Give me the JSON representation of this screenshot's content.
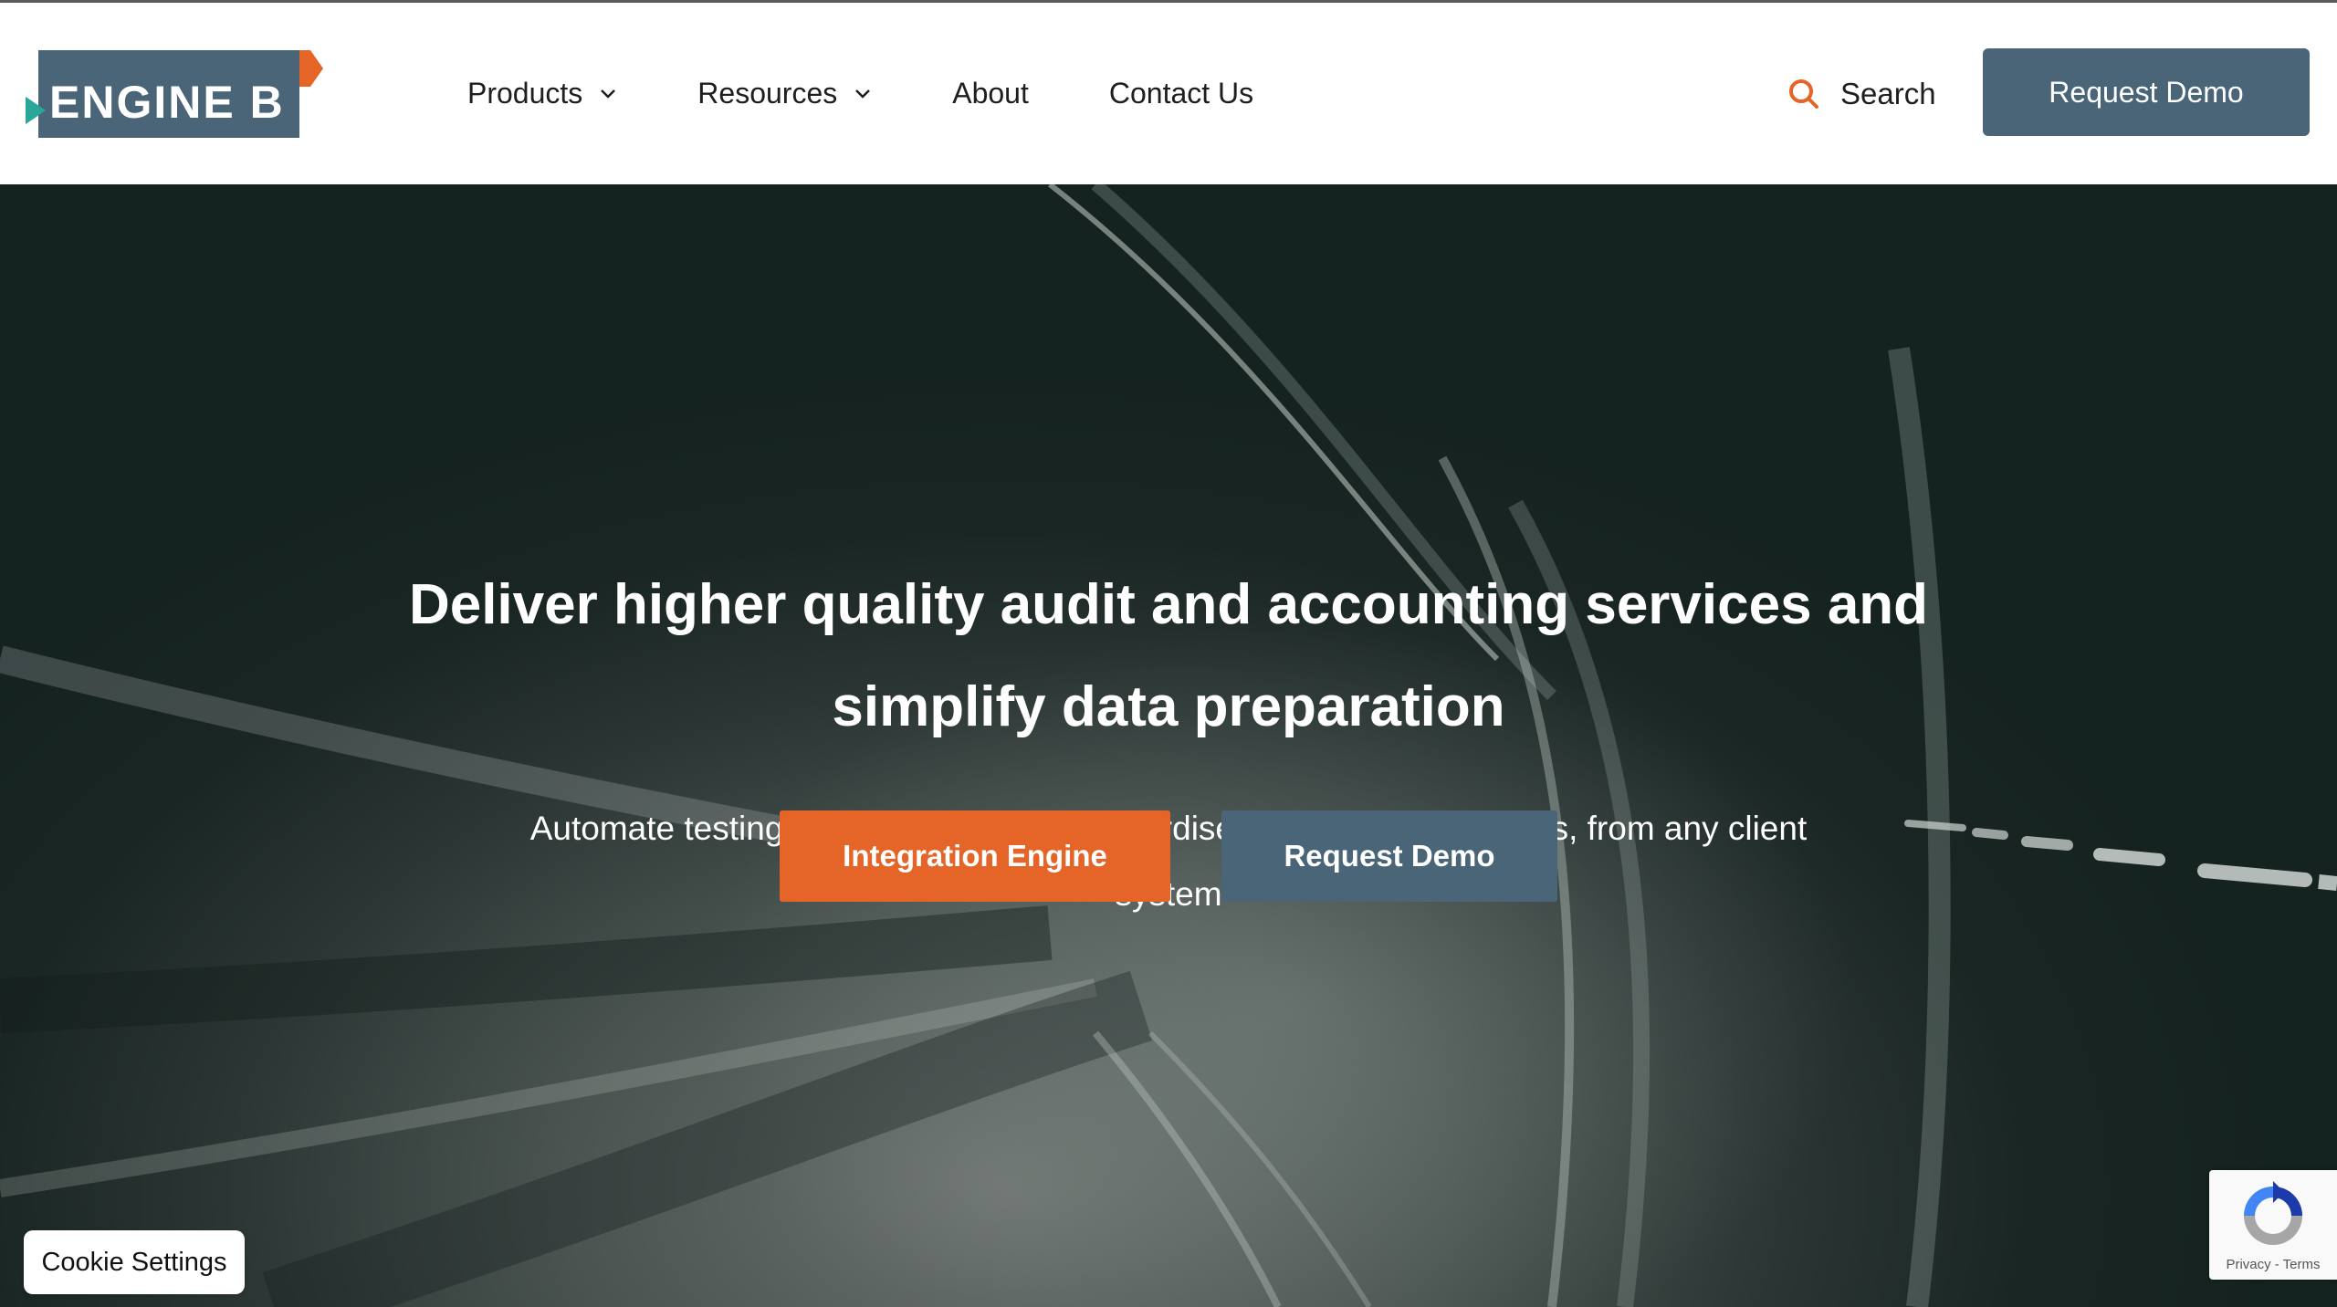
{
  "brand": {
    "name": "ENGINE B",
    "colors": {
      "accent": "#e46527",
      "teal": "#2ba79a",
      "slate": "#4a6578"
    }
  },
  "nav": {
    "items": [
      {
        "label": "Products",
        "has_dropdown": true
      },
      {
        "label": "Resources",
        "has_dropdown": true
      },
      {
        "label": "About",
        "has_dropdown": false
      },
      {
        "label": "Contact Us",
        "has_dropdown": false
      }
    ]
  },
  "header": {
    "search_label": "Search",
    "search_icon": "search-icon",
    "demo_button": "Request Demo"
  },
  "hero": {
    "title": "Deliver higher quality audit and accounting services and simplify data preparation",
    "subtitle": "Automate testing and analysis with standardised data from all ledgers, from any client system",
    "primary_button": "Integration Engine",
    "secondary_button": "Request Demo"
  },
  "cookie": {
    "label": "Cookie Settings"
  },
  "recaptcha": {
    "terms": "Privacy - Terms"
  }
}
